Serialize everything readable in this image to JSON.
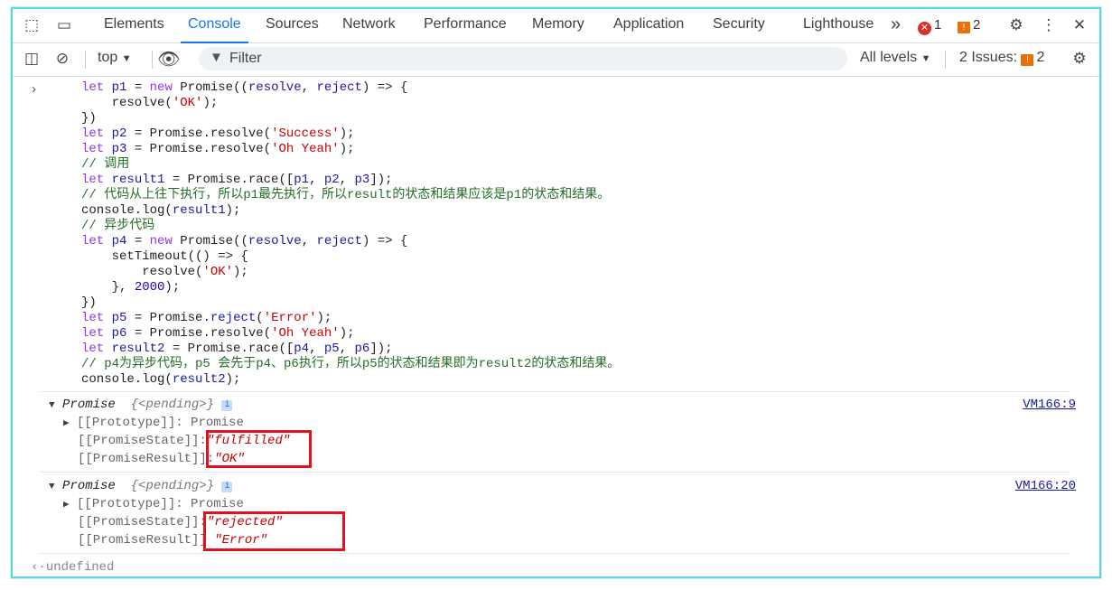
{
  "tabs": [
    "Elements",
    "Console",
    "Sources",
    "Network",
    "Performance",
    "Memory",
    "Application",
    "Security",
    "Lighthouse"
  ],
  "active_tab": "Console",
  "overflow": "»",
  "error_count": "1",
  "warning_count": "2",
  "toolbar": {
    "context": "top",
    "filter_placeholder": "Filter",
    "levels": "All levels",
    "issues_label": "2 Issues:",
    "issues_count": "2"
  },
  "code_lines": [
    "let p1 = new Promise((resolve, reject) => {",
    "    resolve('OK');",
    "})",
    "let p2 = Promise.resolve('Success');",
    "let p3 = Promise.resolve('Oh Yeah');",
    "// 调用",
    "let result1 = Promise.race([p1, p2, p3]);",
    "// 代码从上往下执行，所以p1最先执行，所以result的状态和结果应该是p1的状态和结果。",
    "console.log(result1);",
    "// 异步代码",
    "let p4 = new Promise((resolve, reject) => {",
    "    setTimeout(() => {",
    "        resolve('OK');",
    "    }, 2000);",
    "})",
    "let p5 = Promise.reject('Error');",
    "let p6 = Promise.resolve('Oh Yeah');",
    "let result2 = Promise.race([p4, p5, p6]);",
    "// p4为异步代码，p5 会先于p4、p6执行，所以p5的状态和结果即为result2的状态和结果。",
    "console.log(result2);"
  ],
  "entries": [
    {
      "title": "Promise",
      "pending": "{<pending>}",
      "info": "i",
      "prototype": "[[Prototype]]: Promise",
      "state_key": "[[PromiseState]]:",
      "state_val": "\"fulfilled\"",
      "result_key": "[[PromiseResult]]:",
      "result_val": "\"OK\"",
      "source": "VM166:9"
    },
    {
      "title": "Promise",
      "pending": "{<pending>}",
      "info": "i",
      "prototype": "[[Prototype]]: Promise",
      "state_key": "[[PromiseState]]:",
      "state_val": "\"rejected\"",
      "result_key": "[[PromiseResult]]",
      "result_val": "\"Error\"",
      "source": "VM166:20"
    }
  ],
  "return_value": "undefined"
}
